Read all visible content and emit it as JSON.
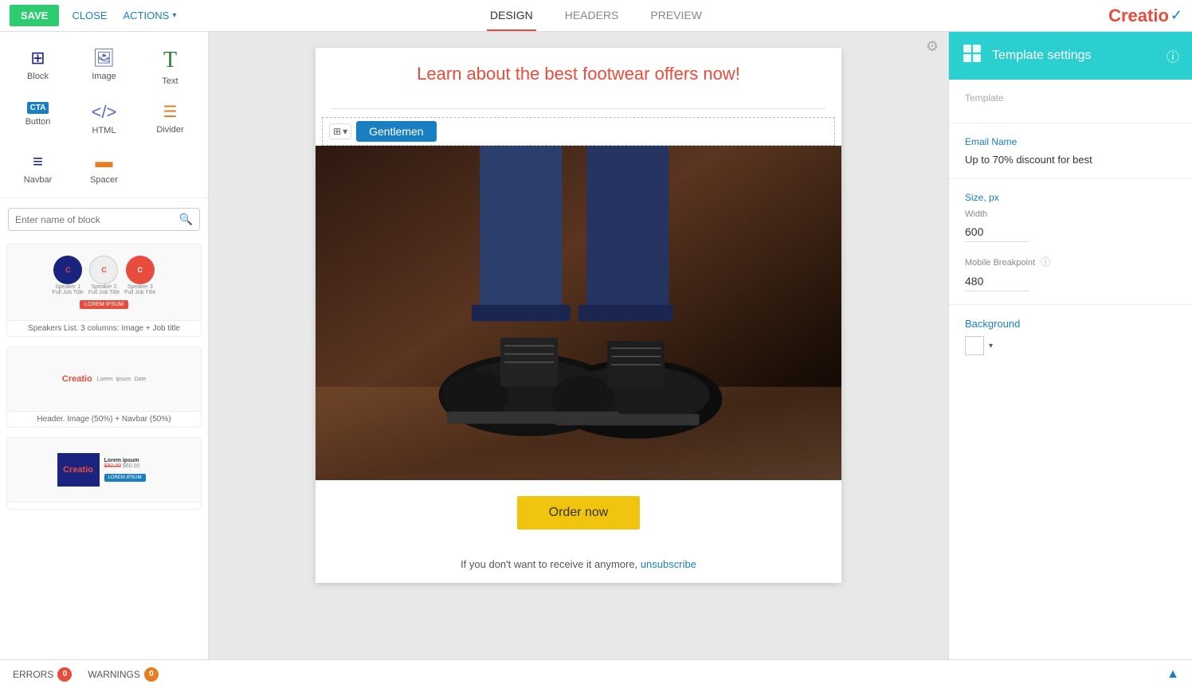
{
  "topbar": {
    "save_label": "SAVE",
    "close_label": "CLOSE",
    "actions_label": "ACTIONS",
    "tabs": [
      {
        "label": "DESIGN",
        "active": true
      },
      {
        "label": "HEADERS",
        "active": false
      },
      {
        "label": "PREVIEW",
        "active": false
      }
    ],
    "logo_text": "Creatio"
  },
  "left_sidebar": {
    "widgets": [
      {
        "id": "block",
        "label": "Block",
        "icon": "⊞",
        "type": "block"
      },
      {
        "id": "image",
        "label": "Image",
        "icon": "🖼",
        "type": "image"
      },
      {
        "id": "text",
        "label": "Text",
        "icon": "T",
        "type": "text"
      },
      {
        "id": "cta",
        "label": "Button",
        "icon": "CTA",
        "type": "cta"
      },
      {
        "id": "html",
        "label": "HTML",
        "icon": "</>",
        "type": "html"
      },
      {
        "id": "divider",
        "label": "Divider",
        "icon": "☰",
        "type": "divider"
      },
      {
        "id": "navbar",
        "label": "Navbar",
        "icon": "≡",
        "type": "navbar"
      },
      {
        "id": "spacer",
        "label": "Spacer",
        "icon": "▬",
        "type": "spacer"
      }
    ],
    "search_placeholder": "Enter name of block",
    "blocks": [
      {
        "id": "speakers-block",
        "label": "Speakers List. 3 columns: Image + Job title"
      },
      {
        "id": "header-block",
        "label": "Header. Image (50%) + Navbar (50%)"
      },
      {
        "id": "product-block",
        "label": ""
      }
    ]
  },
  "canvas": {
    "headline": "Learn about the best footwear offers now!",
    "tab_label": "Gentlemen",
    "order_btn": "Order now",
    "footer_text": "If you don't want to receive it anymore, ",
    "unsubscribe_text": "unsubscribe"
  },
  "right_sidebar": {
    "header": {
      "title": "Template settings",
      "icon": "📋"
    },
    "template_section": {
      "label": "Template"
    },
    "email_name": {
      "label": "Email Name",
      "value": "Up to 70% discount for best"
    },
    "size": {
      "label": "Size, px",
      "width_label": "Width",
      "width_value": "600",
      "breakpoint_label": "Mobile Breakpoint",
      "breakpoint_value": "480"
    },
    "background": {
      "label": "Background"
    }
  },
  "bottom_bar": {
    "errors_label": "ERRORS",
    "errors_count": "0",
    "warnings_label": "WARNINGS",
    "warnings_count": "0"
  }
}
